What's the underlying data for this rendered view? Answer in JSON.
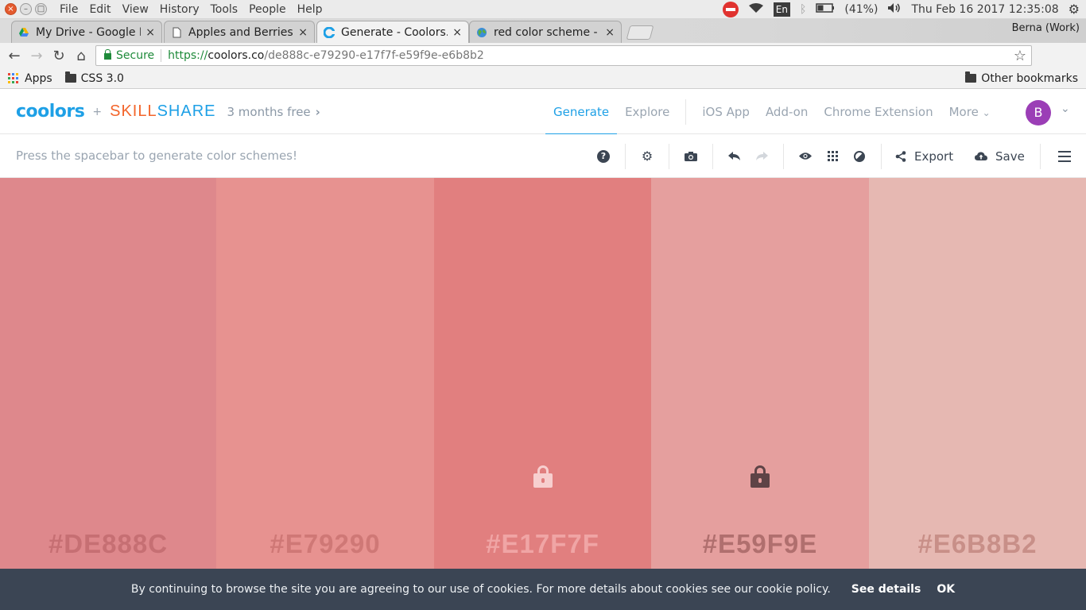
{
  "os": {
    "menu": [
      "File",
      "Edit",
      "View",
      "History",
      "Tools",
      "People",
      "Help"
    ],
    "keyboard": "En",
    "battery": "(41%)",
    "datetime": "Thu Feb 16 2017 12:35:08"
  },
  "tabs": [
    {
      "title": "My Drive - Google Dr",
      "icon": "google-drive-icon"
    },
    {
      "title": "Apples and Berries P",
      "icon": "document-icon"
    },
    {
      "title": "Generate - Coolors.c",
      "icon": "coolors-icon",
      "active": true
    },
    {
      "title": "red color scheme - Ec",
      "icon": "globe-icon"
    }
  ],
  "profile": "Berna (Work)",
  "address": {
    "secure_label": "Secure",
    "protocol": "https://",
    "host": "coolors.co",
    "path": "/de888c-e79290-e17f7f-e59f9e-e6b8b2"
  },
  "bookmarks": {
    "apps": "Apps",
    "folder": "CSS 3.0",
    "other": "Other bookmarks"
  },
  "site": {
    "logo": "coolors",
    "partner_a": "SKILL",
    "partner_b": "SHARE",
    "promo": "3 months free",
    "nav": [
      "Generate",
      "Explore",
      "iOS App",
      "Add-on",
      "Chrome Extension",
      "More"
    ],
    "avatar": "B"
  },
  "toolbar": {
    "hint": "Press the spacebar to generate color schemes!",
    "export_label": "Export",
    "save_label": "Save"
  },
  "palette": [
    {
      "hex": "#DE888C",
      "color": "#de888c",
      "text_color": "#c66f73",
      "locked": false
    },
    {
      "hex": "#E79290",
      "color": "#e79290",
      "text_color": "#cf7876",
      "locked": false
    },
    {
      "hex": "#E17F7F",
      "color": "#e17f7f",
      "text_color": "#f0a5a5",
      "locked": true,
      "lock_color": "#f7cfcf"
    },
    {
      "hex": "#E59F9E",
      "color": "#e59f9e",
      "text_color": "#b06f6e",
      "locked": true,
      "lock_color": "#5e4346"
    },
    {
      "hex": "#E6B8B2",
      "color": "#e6b8b2",
      "text_color": "#c88f88",
      "locked": false
    }
  ],
  "cookie": {
    "message": "By continuing to browse the site you are agreeing to our use of cookies. For more details about cookies see our cookie policy.",
    "details": "See details",
    "ok": "OK"
  }
}
